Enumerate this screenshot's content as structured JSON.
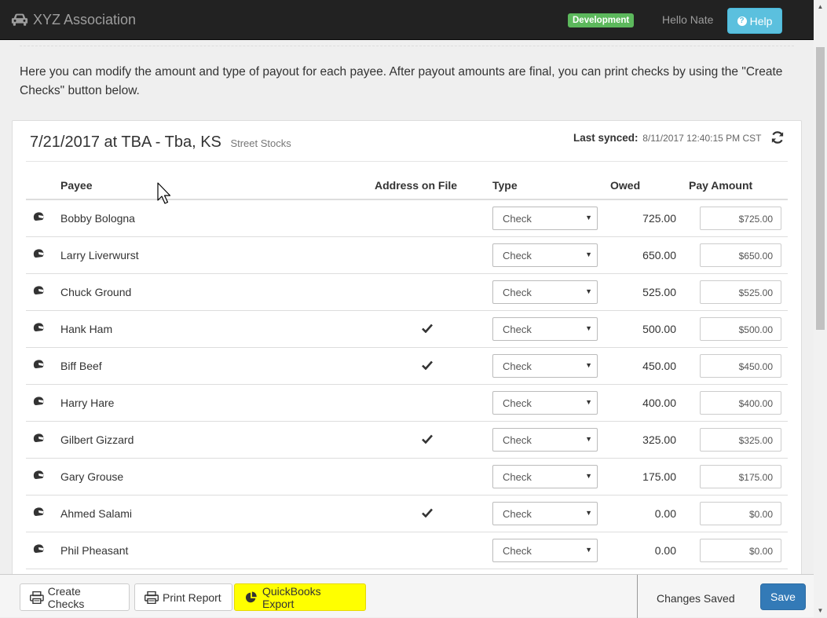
{
  "app": {
    "title": "XYZ Association",
    "env_badge": "Development",
    "greeting": "Hello Nate",
    "help_label": "Help"
  },
  "intro_text": "Here you can modify the amount and type of payout for each payee. After payout amounts are final, you can print checks by using the \"Create Checks\" button below.",
  "event": {
    "title": "7/21/2017 at TBA - Tba, KS",
    "class": "Street Stocks",
    "synced_label": "Last synced:",
    "synced_time": "8/11/2017 12:40:15 PM CST"
  },
  "table": {
    "headers": {
      "payee": "Payee",
      "address": "Address on File",
      "type": "Type",
      "owed": "Owed",
      "pay_amount": "Pay Amount"
    },
    "rows": [
      {
        "name": "Bobby Bologna",
        "address_on_file": false,
        "type": "Check",
        "owed": "725.00",
        "pay": "$725.00"
      },
      {
        "name": "Larry Liverwurst",
        "address_on_file": false,
        "type": "Check",
        "owed": "650.00",
        "pay": "$650.00"
      },
      {
        "name": "Chuck Ground",
        "address_on_file": false,
        "type": "Check",
        "owed": "525.00",
        "pay": "$525.00"
      },
      {
        "name": "Hank Ham",
        "address_on_file": true,
        "type": "Check",
        "owed": "500.00",
        "pay": "$500.00"
      },
      {
        "name": "Biff Beef",
        "address_on_file": true,
        "type": "Check",
        "owed": "450.00",
        "pay": "$450.00"
      },
      {
        "name": "Harry Hare",
        "address_on_file": false,
        "type": "Check",
        "owed": "400.00",
        "pay": "$400.00"
      },
      {
        "name": "Gilbert Gizzard",
        "address_on_file": true,
        "type": "Check",
        "owed": "325.00",
        "pay": "$325.00"
      },
      {
        "name": "Gary Grouse",
        "address_on_file": false,
        "type": "Check",
        "owed": "175.00",
        "pay": "$175.00"
      },
      {
        "name": "Ahmed Salami",
        "address_on_file": true,
        "type": "Check",
        "owed": "0.00",
        "pay": "$0.00"
      },
      {
        "name": "Phil Pheasant",
        "address_on_file": false,
        "type": "Check",
        "owed": "0.00",
        "pay": "$0.00"
      }
    ]
  },
  "footer": {
    "create_checks": "Create Checks",
    "print_report": "Print Report",
    "quickbooks_export": "QuickBooks Export",
    "status": "Changes Saved",
    "save": "Save"
  },
  "colors": {
    "navbar": "#222222",
    "dev_badge": "#5cb85c",
    "help": "#5bc0de",
    "save": "#337ab7",
    "highlight": "#ffff00"
  }
}
